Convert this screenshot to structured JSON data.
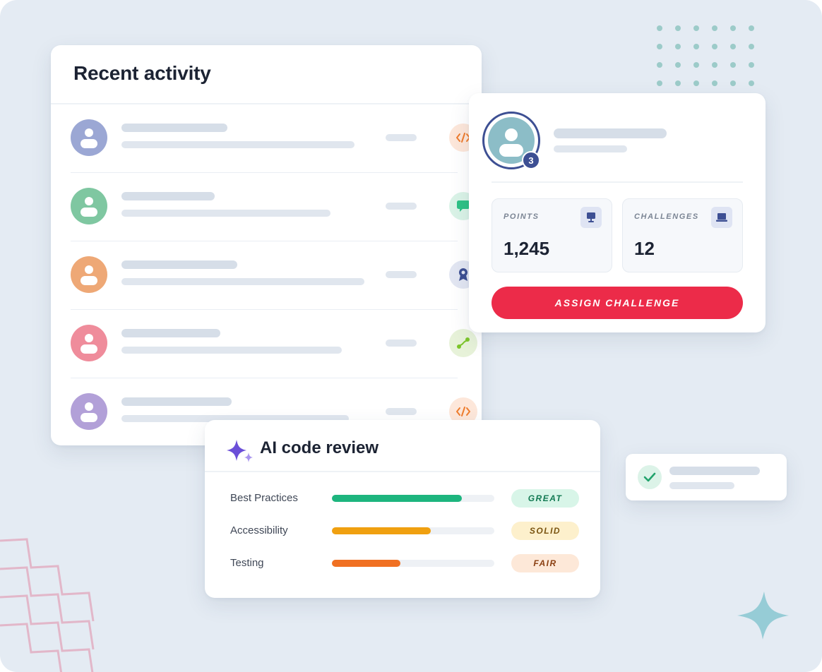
{
  "recent_activity": {
    "title": "Recent activity",
    "rows": [
      {
        "avatar_color": "#9ba7d4",
        "icon": "code-icon",
        "icon_bg": "#fde7da",
        "icon_color": "#ef7d2e"
      },
      {
        "avatar_color": "#7fc7a1",
        "icon": "chat-icon",
        "icon_bg": "#daf3e7",
        "icon_color": "#2ec286"
      },
      {
        "avatar_color": "#eea876",
        "icon": "award-icon",
        "icon_bg": "#e2e6f2",
        "icon_color": "#3d4f93"
      },
      {
        "avatar_color": "#ef8c9b",
        "icon": "route-icon",
        "icon_bg": "#e7f2d9",
        "icon_color": "#7cc52a"
      },
      {
        "avatar_color": "#b2a0d8",
        "icon": "code-icon",
        "icon_bg": "#fde7da",
        "icon_color": "#ef7d2e"
      }
    ]
  },
  "profile": {
    "rank_badge": "3",
    "stats": [
      {
        "label": "POINTS",
        "value": "1,245",
        "icon": "monitor-icon"
      },
      {
        "label": "CHALLENGES",
        "value": "12",
        "icon": "laptop-icon"
      }
    ],
    "assign_button": "ASSIGN CHALLENGE"
  },
  "ai_review": {
    "title": "AI code review",
    "icon": "sparkle-icon",
    "metrics": [
      {
        "label": "Best Practices",
        "score": 0.8,
        "rating": "GREAT",
        "fill_color": "#1db57e",
        "pill_bg": "#d8f5e8",
        "pill_color": "#137a53"
      },
      {
        "label": "Accessibility",
        "score": 0.61,
        "rating": "SOLID",
        "fill_color": "#f0a010",
        "pill_bg": "#fdf0cc",
        "pill_color": "#7a5410"
      },
      {
        "label": "Testing",
        "score": 0.42,
        "rating": "FAIR",
        "fill_color": "#f07022",
        "pill_bg": "#fde8d8",
        "pill_color": "#8a3f12"
      }
    ]
  },
  "notification": {
    "icon": "check-icon"
  },
  "colors": {
    "background": "#e4ebf3",
    "accent": "#ec2b49",
    "brand_navy": "#3d4f93",
    "skeleton": "#d6dee8"
  }
}
